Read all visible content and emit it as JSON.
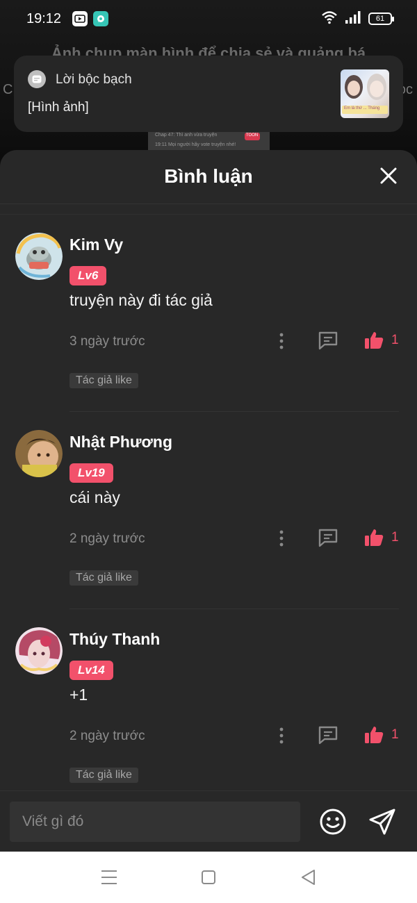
{
  "status_bar": {
    "time": "19:12",
    "battery": "61",
    "icons": [
      "youtube-icon",
      "chat-bubble-icon",
      "wifi-icon",
      "signal-icon",
      "battery-icon"
    ]
  },
  "background": {
    "caption": "Ảnh chụp màn hình để chia sẻ và quảng bá",
    "left_edge": "C",
    "right_edge": "oc",
    "thumb_line1": "Chap 47: Thì anh vừa truyện",
    "thumb_line2": "19:11 Mọi người hãy vote truyện nhé!",
    "thumb_badge": "TOON"
  },
  "notification": {
    "app_name": "Lời bộc bạch",
    "body": "[Hình ảnh]",
    "thumb_caption": "Em là thứ ... Tháng"
  },
  "sheet": {
    "title": "Bình luận"
  },
  "comments": [
    {
      "username": "Kim Vy",
      "level": "Lv6",
      "text": "truyện này đi tác giả",
      "time": "3 ngày trước",
      "likes": "1",
      "tag": "Tác giả like"
    },
    {
      "username": "Nhật Phương",
      "level": "Lv19",
      "text": "cái này",
      "time": "2 ngày trước",
      "likes": "1",
      "tag": "Tác giả like"
    },
    {
      "username": "Thúy Thanh",
      "level": "Lv14",
      "text": "+1",
      "time": "2 ngày trước",
      "likes": "1",
      "tag": "Tác giả like"
    }
  ],
  "input": {
    "placeholder": "Viết gì đó"
  },
  "colors": {
    "accent": "#f2516b",
    "sheet_bg": "#282828",
    "caret": "#2ec4a6"
  }
}
